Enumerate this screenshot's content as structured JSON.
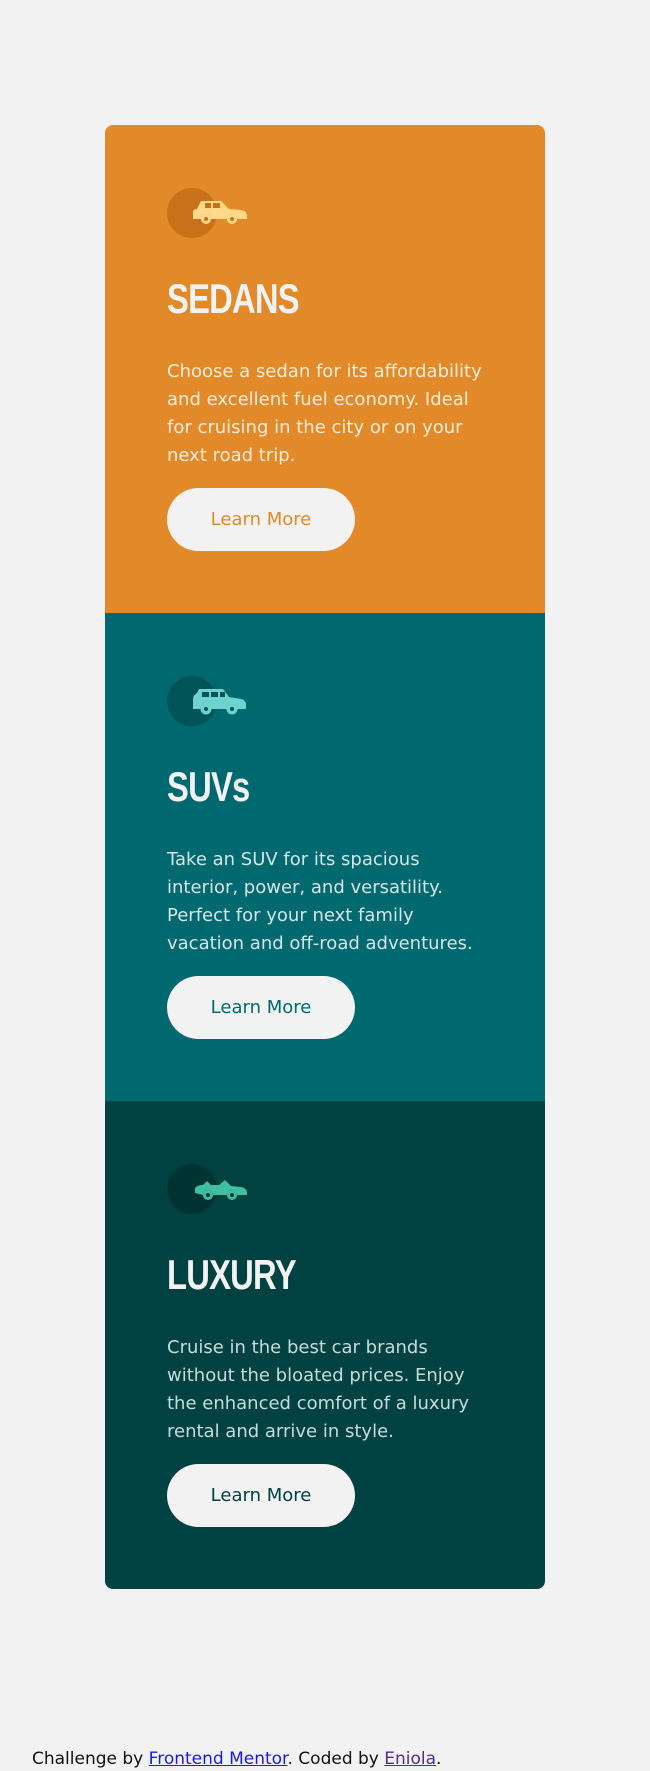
{
  "colors": {
    "page_background": "#f2f2f2",
    "sedans": "#e28a29",
    "suvs": "#006970",
    "luxury": "#004241",
    "button_background": "#f2f2f2"
  },
  "cards": [
    {
      "icon": "sedan-car-icon",
      "title": "SEDANS",
      "text": "Choose a sedan for its affordability and excellent fuel economy. Ideal for cruising in the city or on your next road trip.",
      "button_label": "Learn More"
    },
    {
      "icon": "suv-car-icon",
      "title": "SUVs",
      "text": "Take an SUV for its spacious interior, power, and versatility. Perfect for your next family vacation and off-road adventures.",
      "button_label": "Learn More"
    },
    {
      "icon": "luxury-car-icon",
      "title": "LUXURY",
      "text": "Cruise in the best car brands without the bloated prices. Enjoy the enhanced comfort of a luxury rental and arrive in style.",
      "button_label": "Learn More"
    }
  ],
  "attribution": {
    "prefix": "Challenge by ",
    "challenge_link": "Frontend Mentor",
    "middle": ". Coded by ",
    "author_link": "Eniola",
    "suffix": "."
  }
}
